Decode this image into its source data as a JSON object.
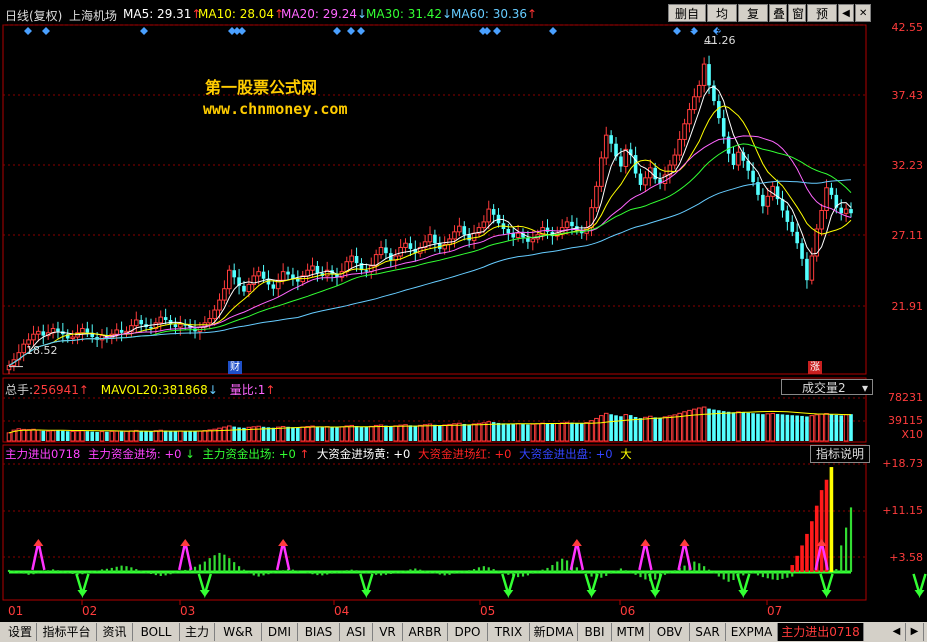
{
  "header": {
    "period": "日线(复权)",
    "stock": "上海机场",
    "ma": [
      {
        "label": "MA5: 29.31",
        "arrow": "↑",
        "color": "#ffffff"
      },
      {
        "label": "MA10: 28.04",
        "arrow": "↑",
        "color": "#ffff00"
      },
      {
        "label": "MA20: 29.24",
        "arrow": "↓",
        "color": "#ff66ff"
      },
      {
        "label": "MA30: 31.42",
        "arrow": "↓",
        "color": "#33ff33"
      },
      {
        "label": "MA60: 30.36",
        "arrow": "↑",
        "color": "#66ccff"
      }
    ]
  },
  "toolbar": {
    "b1": "删自选",
    "b2": "均线",
    "b3": "复权",
    "b4": "叠",
    "b5": "窗",
    "b6": "预测",
    "prev": "◀",
    "close": "✕"
  },
  "watermark": {
    "line1": "第一股票公式网",
    "line2": "www.chnmoney.com"
  },
  "price_panel": {
    "high_label": "41.26",
    "low_label": "18.52",
    "y_ticks": [
      "42.55",
      "37.43",
      "32.23",
      "27.11",
      "21.91"
    ],
    "markers": {
      "cai": "财",
      "zhang": "涨"
    }
  },
  "volume_panel": {
    "total_label": "总手:",
    "total_value": "256941",
    "total_arrow": "↑",
    "mavol_label": "MAVOL20:",
    "mavol_value": "381868",
    "mavol_arrow": "↓",
    "ratio_label": "量比:",
    "ratio_value": "1",
    "ratio_arrow": "↑",
    "selector": "成交量2",
    "selector_caret": "▾",
    "y_ticks": [
      "78231",
      "39115",
      "X10"
    ]
  },
  "indicator_panel": {
    "items": [
      {
        "text": "主力进出0718",
        "color": "#ff44ff"
      },
      {
        "text": "主力资金进场: +0",
        "color": "#ff44ff"
      },
      {
        "text": "↓",
        "color": "#33ff33"
      },
      {
        "text": "主力资金出场: +0",
        "color": "#33ff33"
      },
      {
        "text": "↑",
        "color": "#ff3333"
      },
      {
        "text": "大资金进场黄: +0",
        "color": "#ffffff"
      },
      {
        "text": "大资金进场红: +0",
        "color": "#ff2222"
      },
      {
        "text": "大资金进出盘: +0",
        "color": "#3344ff"
      },
      {
        "text": "大",
        "color": "#ffff00"
      }
    ],
    "help_button": "指标说明",
    "y_ticks": [
      "+18.73",
      "+11.15",
      "+3.58"
    ]
  },
  "x_axis": {
    "labels": [
      "01",
      "02",
      "03",
      "04",
      "05",
      "06",
      "07"
    ]
  },
  "tabs": [
    "设置",
    "指标平台",
    "资讯",
    "BOLL",
    "主力",
    "W&R",
    "DMI",
    "BIAS",
    "ASI",
    "VR",
    "ARBR",
    "DPO",
    "TRIX",
    "新DMA",
    "BBI",
    "MTM",
    "OBV",
    "SAR",
    "EXPMA",
    "主力进出0718"
  ],
  "tab_icons": [
    "prev-arrow-icon",
    "next-arrow-icon"
  ],
  "chart_data": {
    "type": "candlestick",
    "price_ylim": [
      18.0,
      42.55
    ],
    "close": [
      18.6,
      19.0,
      19.5,
      20.1,
      20.4,
      20.8,
      21.0,
      20.7,
      20.9,
      21.2,
      21.0,
      20.8,
      20.5,
      20.6,
      20.9,
      21.2,
      20.9,
      20.6,
      20.4,
      20.7,
      20.5,
      20.8,
      21.1,
      20.9,
      21.0,
      21.4,
      21.8,
      21.5,
      21.3,
      21.2,
      21.6,
      22.0,
      21.8,
      21.5,
      21.3,
      21.5,
      21.4,
      21.2,
      21.0,
      21.3,
      21.6,
      21.9,
      22.5,
      23.2,
      24.0,
      25.3,
      24.8,
      24.2,
      23.8,
      24.3,
      24.9,
      25.2,
      24.7,
      24.3,
      24.0,
      24.6,
      25.2,
      25.0,
      24.7,
      24.5,
      24.9,
      25.3,
      25.6,
      25.1,
      24.9,
      25.3,
      25.0,
      24.8,
      25.2,
      25.9,
      26.3,
      25.8,
      25.3,
      25.2,
      25.6,
      26.4,
      26.9,
      26.5,
      26.0,
      26.3,
      26.9,
      27.2,
      26.8,
      26.5,
      26.9,
      27.3,
      27.8,
      27.2,
      26.8,
      27.1,
      27.5,
      28.0,
      28.4,
      27.8,
      27.4,
      27.9,
      28.3,
      28.7,
      29.6,
      29.2,
      28.6,
      28.2,
      27.9,
      27.6,
      27.9,
      27.6,
      27.3,
      27.5,
      27.8,
      28.3,
      28.0,
      27.7,
      27.9,
      28.3,
      28.7,
      28.4,
      28.1,
      27.9,
      28.3,
      29.7,
      31.2,
      33.2,
      34.8,
      34.2,
      33.3,
      32.6,
      33.8,
      33.4,
      32.1,
      31.3,
      31.8,
      32.5,
      31.7,
      31.4,
      32.0,
      32.7,
      33.4,
      34.5,
      35.6,
      36.6,
      37.5,
      38.3,
      39.8,
      38.3,
      37.2,
      36.0,
      34.7,
      33.5,
      32.7,
      33.6,
      33.0,
      32.3,
      31.5,
      30.6,
      29.8,
      30.5,
      31.2,
      30.3,
      29.5,
      28.7,
      28.0,
      27.2,
      26.1,
      24.6,
      26.3,
      28.2,
      29.5,
      31.1,
      30.6,
      29.7,
      29.3,
      29.6,
      29.31
    ],
    "volume_scale_max": 78231,
    "volume": [
      7800,
      10400,
      11700,
      11100,
      10900,
      11200,
      10400,
      9800,
      9400,
      9800,
      10200,
      9800,
      9400,
      9200,
      9500,
      9800,
      9400,
      9000,
      8700,
      9000,
      8900,
      9200,
      9400,
      9100,
      9300,
      9700,
      10100,
      9800,
      9600,
      9500,
      9900,
      10300,
      10000,
      9600,
      9400,
      9600,
      9500,
      9300,
      9100,
      9400,
      10000,
      10600,
      11300,
      12300,
      13300,
      14400,
      13800,
      13000,
      12600,
      13100,
      13600,
      14100,
      13600,
      13100,
      12700,
      13300,
      13900,
      13600,
      13200,
      12900,
      13400,
      13900,
      14300,
      13700,
      13400,
      13800,
      13500,
      13200,
      13600,
      14400,
      14900,
      14300,
      13700,
      13500,
      14000,
      14900,
      15300,
      14700,
      14200,
      14500,
      15200,
      15600,
      15000,
      14600,
      15000,
      15600,
      16200,
      15500,
      15000,
      15300,
      15900,
      16500,
      17000,
      16300,
      15800,
      16300,
      16900,
      17400,
      18500,
      18100,
      17300,
      16900,
      16500,
      16200,
      16600,
      16200,
      15800,
      16100,
      16500,
      17100,
      16800,
      16500,
      16800,
      17300,
      17900,
      17600,
      17300,
      17000,
      17600,
      19500,
      21600,
      24300,
      26500,
      25600,
      24600,
      23700,
      25300,
      24800,
      23000,
      21900,
      22700,
      23700,
      22600,
      22200,
      23100,
      24000,
      25000,
      26500,
      28000,
      29300,
      30500,
      31600,
      32500,
      31000,
      30100,
      29400,
      28600,
      28000,
      27500,
      27900,
      27400,
      27000,
      26600,
      26100,
      25700,
      26000,
      26400,
      25900,
      25500,
      25100,
      24700,
      24400,
      24000,
      23500,
      24300,
      25100,
      25700,
      26300,
      25800,
      25000,
      24500,
      25200,
      25694
    ],
    "indicator_ylim": [
      -4.0,
      18.73
    ],
    "indicator_red": [
      0,
      0,
      0,
      0,
      0,
      0,
      0,
      0,
      0,
      0,
      0,
      0,
      0,
      0,
      0,
      0,
      0,
      0,
      0,
      0,
      0,
      0,
      0,
      0,
      0,
      0,
      0,
      0,
      0,
      0,
      0,
      0,
      0,
      0,
      0,
      0,
      0,
      0,
      0,
      0,
      0,
      0,
      0,
      0,
      0,
      0,
      0,
      0,
      0,
      0,
      0,
      0,
      0,
      0,
      0,
      0,
      0,
      0,
      0,
      0,
      0,
      0,
      0,
      0,
      0,
      0,
      0,
      0,
      0,
      0,
      0,
      0,
      0,
      0,
      0,
      0,
      0,
      0,
      0,
      0,
      0,
      0,
      0,
      0,
      0,
      0,
      0,
      0,
      0,
      0,
      0,
      0,
      0,
      0,
      0,
      0,
      0,
      0,
      0,
      0,
      0,
      0,
      0,
      0,
      0,
      0,
      0,
      0,
      0,
      0,
      0,
      0,
      0,
      0,
      0,
      0,
      0,
      0,
      0,
      0,
      0,
      0,
      0,
      0,
      0,
      0,
      0,
      0,
      0,
      0,
      0,
      0,
      0,
      0,
      0,
      0,
      0,
      0,
      0,
      0,
      0,
      0,
      0,
      0,
      0,
      0,
      0,
      0,
      0,
      0,
      0,
      0,
      0,
      0,
      0,
      0,
      0,
      0,
      0,
      0,
      1.2,
      2.8,
      4.6,
      6.6,
      8.8,
      11.5,
      14.2,
      16.0,
      0,
      0,
      0,
      0,
      0,
      0,
      0,
      0
    ],
    "indicator_green": [
      0.35,
      0.15,
      -0.1,
      -0.3,
      -0.5,
      -0.4,
      -0.2,
      0.1,
      0.3,
      0.45,
      0.3,
      0.1,
      -0.15,
      -0.35,
      -0.55,
      -0.4,
      -0.2,
      0.05,
      0.25,
      0.45,
      0.55,
      0.7,
      0.9,
      1.1,
      1.0,
      0.8,
      0.5,
      0.2,
      -0.1,
      -0.35,
      -0.55,
      -0.7,
      -0.6,
      -0.4,
      -0.2,
      0.1,
      0.35,
      0.6,
      0.9,
      1.3,
      1.8,
      2.4,
      2.9,
      3.3,
      3.0,
      2.4,
      1.7,
      1.0,
      0.4,
      -0.2,
      -0.6,
      -0.8,
      -0.6,
      -0.4,
      -0.2,
      0.1,
      0.3,
      0.5,
      0.4,
      0.2,
      0.0,
      -0.2,
      -0.4,
      -0.55,
      -0.6,
      -0.45,
      -0.3,
      -0.1,
      0.1,
      0.3,
      0.4,
      0.3,
      0.1,
      -0.1,
      -0.3,
      -0.5,
      -0.6,
      -0.5,
      -0.35,
      -0.2,
      0.05,
      0.25,
      0.45,
      0.6,
      0.4,
      0.2,
      -0.05,
      -0.25,
      -0.45,
      -0.6,
      -0.5,
      -0.3,
      -0.1,
      0.1,
      0.3,
      0.5,
      0.8,
      1.0,
      0.8,
      0.5,
      0.2,
      -0.2,
      -0.5,
      -0.7,
      -0.9,
      -0.8,
      -0.6,
      -0.3,
      0.1,
      0.4,
      0.7,
      1.2,
      1.8,
      2.3,
      2.0,
      1.4,
      0.8,
      0.3,
      -0.3,
      -0.8,
      -1.2,
      -1.0,
      -0.7,
      -0.3,
      0.2,
      0.6,
      0.3,
      -0.1,
      -0.5,
      -0.9,
      -1.3,
      -1.6,
      -1.3,
      -0.9,
      -0.5,
      -0.1,
      0.3,
      0.7,
      1.1,
      1.5,
      1.8,
      1.5,
      1.0,
      0.4,
      -0.2,
      -0.8,
      -1.3,
      -1.7,
      -1.4,
      -1.0,
      -0.6,
      -0.3,
      -0.1,
      -0.6,
      -0.9,
      -1.1,
      -1.3,
      -1.4,
      -1.2,
      -1.0,
      -0.8,
      0,
      0,
      0,
      0,
      0,
      0,
      0,
      0,
      0.5,
      4.6,
      7.7,
      11.2,
      6.2,
      3.5,
      3.2,
      1.6
    ],
    "indicator_yellow": [
      0,
      0,
      0,
      0,
      0,
      0,
      0,
      0,
      0,
      0,
      0,
      0,
      0,
      0,
      0,
      0,
      0,
      0,
      0,
      0,
      0,
      0,
      0,
      0,
      0,
      0,
      0,
      0,
      0,
      0,
      0,
      0,
      0,
      0,
      0,
      0,
      0,
      0,
      0,
      0,
      0,
      0,
      0,
      0,
      0,
      0,
      0,
      0,
      0,
      0,
      0,
      0,
      0,
      0,
      0,
      0,
      0,
      0,
      0,
      0,
      0,
      0,
      0,
      0,
      0,
      0,
      0,
      0,
      0,
      0,
      0,
      0,
      0,
      0,
      0,
      0,
      0,
      0,
      0,
      0,
      0,
      0,
      0,
      0,
      0,
      0,
      0,
      0,
      0,
      0,
      0,
      0,
      0,
      0,
      0,
      0,
      0,
      0,
      0,
      0,
      0,
      0,
      0,
      0,
      0,
      0,
      0,
      0,
      0,
      0,
      0,
      0,
      0,
      0,
      0,
      0,
      0,
      0,
      0,
      0,
      0,
      0,
      0,
      0,
      0,
      0,
      0,
      0,
      0,
      0,
      0,
      0,
      0,
      0,
      0,
      0,
      0,
      0,
      0,
      0,
      0,
      0,
      0,
      0,
      0,
      0,
      0,
      0,
      0,
      0,
      0,
      0,
      0,
      0,
      0,
      0,
      0,
      0,
      0,
      0,
      0,
      0,
      0,
      0,
      0,
      0,
      0,
      0,
      18.2,
      0,
      0,
      0,
      0,
      0,
      0,
      0
    ],
    "indicator_blue": [
      0,
      0,
      0,
      0,
      0,
      0,
      0,
      0,
      0,
      0,
      0,
      0,
      0,
      0,
      0,
      0,
      0,
      0,
      0,
      0,
      0,
      0,
      0,
      0,
      0,
      0,
      0,
      0,
      0,
      0,
      0,
      0,
      0,
      0,
      0,
      0,
      0,
      0,
      0,
      0,
      0,
      0,
      0,
      0,
      0,
      0,
      0,
      0,
      0,
      0,
      0,
      0,
      0,
      0,
      0,
      0,
      0,
      0,
      0,
      0,
      0,
      0,
      0,
      0,
      0,
      0,
      0,
      0,
      0,
      0,
      0,
      0,
      0,
      0,
      0,
      0,
      0,
      0,
      0,
      0,
      0,
      0,
      0,
      0,
      0,
      0,
      0,
      0,
      0,
      0,
      0,
      0,
      0,
      0,
      0,
      0,
      0,
      0,
      0,
      0,
      0,
      0,
      0,
      0,
      0,
      0,
      0,
      0,
      0,
      0,
      0,
      0,
      0,
      0,
      0,
      0,
      0,
      0,
      0,
      0,
      0,
      0,
      0,
      0,
      0,
      0,
      0,
      0,
      0,
      0,
      0,
      0,
      0,
      0,
      0,
      0,
      0,
      0,
      0,
      0,
      0,
      0,
      0,
      0,
      0,
      0,
      0,
      0,
      0,
      0,
      0,
      0,
      0,
      0,
      0,
      0,
      0,
      0,
      0,
      0,
      0,
      0,
      0,
      0,
      0,
      0,
      0,
      0,
      0,
      0,
      0,
      0,
      0,
      1.5,
      4.5,
      3.0
    ],
    "magenta_markers_at": [
      6,
      36,
      56,
      116,
      130,
      138,
      166,
      205
    ],
    "green_markers_at": [
      15,
      40,
      73,
      102,
      119,
      132,
      150,
      167,
      186,
      206
    ]
  }
}
